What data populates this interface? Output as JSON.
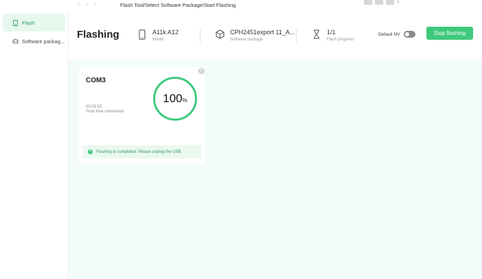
{
  "titlebar": {
    "breadcrumb": "Flash Tool/Select Software Package/Start Flashing"
  },
  "sidebar": {
    "items": [
      {
        "label": "Flash",
        "icon": "phone-icon",
        "active": true
      },
      {
        "label": "Software packag...",
        "icon": "package-icon",
        "active": false
      }
    ]
  },
  "header": {
    "title": "Flashing",
    "model": {
      "value": "A11k A12",
      "label": "Model"
    },
    "package": {
      "value": "CPH2451export 11_A...",
      "label": "Software package"
    },
    "progress": {
      "value": "1/1",
      "label": "Flash progress"
    },
    "default_nv_label": "Default NV",
    "default_nv_on": false,
    "stop_button": "Stop flashing"
  },
  "card": {
    "port": "COM3",
    "time": "00:03:52",
    "time_label": "Total time consumed",
    "percent": "100",
    "percent_sign": "%",
    "notice": "Flashing is completed. Please unplug the USB."
  },
  "colors": {
    "accent": "#3ec97d",
    "active_bg": "#e6f7ee",
    "main_bg": "#f4fcfa"
  }
}
